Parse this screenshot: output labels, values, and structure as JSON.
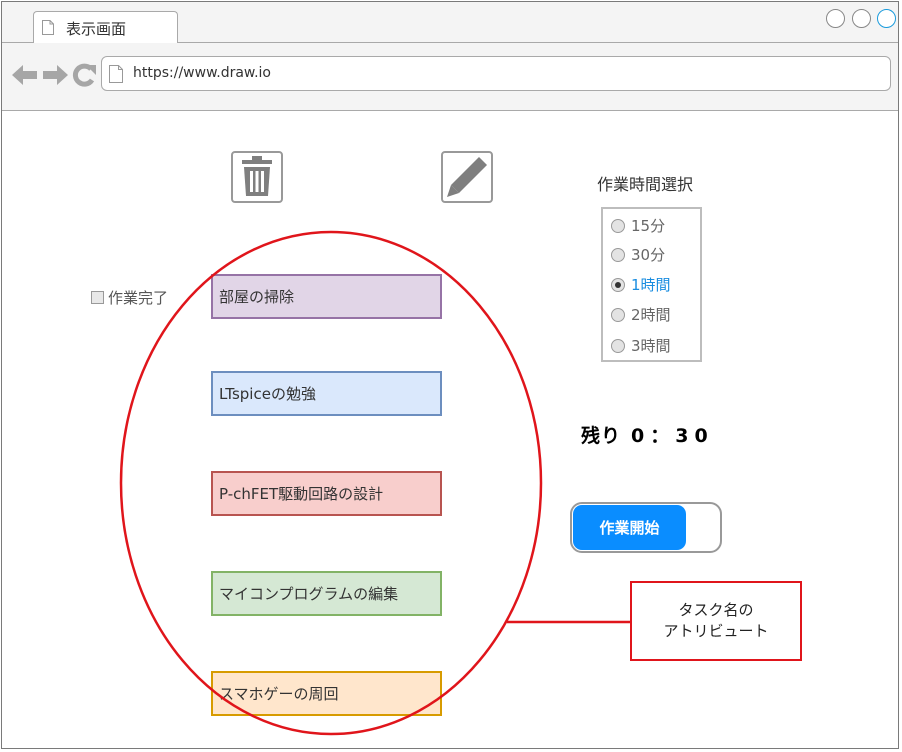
{
  "browser": {
    "tab_title": "表示画面",
    "url": "https://www.draw.io"
  },
  "toolbar": {
    "delete_icon": "trash-icon",
    "edit_icon": "pencil-icon"
  },
  "done_checkbox": {
    "label": "作業完了",
    "checked": false
  },
  "tasks": [
    {
      "name": "部屋の掃除",
      "fill": "#e1d5e7",
      "border": "#9673a6"
    },
    {
      "name": "LTspiceの勉強",
      "fill": "#dae8fc",
      "border": "#6c8ebf"
    },
    {
      "name": "P-chFET駆動回路の設計",
      "fill": "#f8cecc",
      "border": "#b85450"
    },
    {
      "name": "マイコンプログラムの編集",
      "fill": "#d5e8d4",
      "border": "#82b366"
    },
    {
      "name": "スマホゲーの周回",
      "fill": "#ffe6cc",
      "border": "#d79b00"
    }
  ],
  "time_select": {
    "title": "作業時間選択",
    "options": [
      "15分",
      "30分",
      "1時間",
      "2時間",
      "3時間"
    ],
    "selected": "1時間"
  },
  "remaining": {
    "label": "残り",
    "value": "0：30"
  },
  "start_toggle": {
    "label": "作業開始"
  },
  "annotation": {
    "line1": "タスク名の",
    "line2": "アトリビュート",
    "color": "#e0151b"
  }
}
